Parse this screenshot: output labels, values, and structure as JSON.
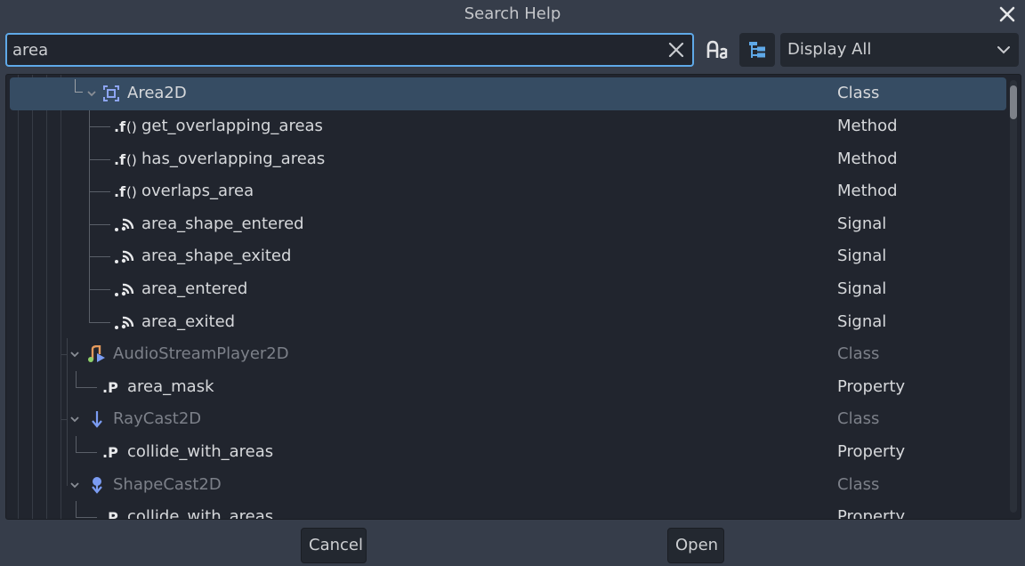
{
  "dialog": {
    "title": "Search Help",
    "close_icon": "close-icon"
  },
  "search": {
    "value": "area",
    "placeholder": "",
    "clear_icon": "clear-icon",
    "case_sensitive_icon": "case-sensitive-icon",
    "hierarchy_icon": "tree-hierarchy-icon",
    "filter_selected": "Display All"
  },
  "colors": {
    "accent": "#5fa9e8",
    "selected_row": "#364c63",
    "background": "#363d4a",
    "panel": "#21252e"
  },
  "results": [
    {
      "name": "Area2D",
      "kind": "Class",
      "icon": "area2d-icon",
      "selected": true,
      "dim": false
    },
    {
      "name": "get_overlapping_areas",
      "kind": "Method",
      "icon": "method-icon"
    },
    {
      "name": "has_overlapping_areas",
      "kind": "Method",
      "icon": "method-icon"
    },
    {
      "name": "overlaps_area",
      "kind": "Method",
      "icon": "method-icon"
    },
    {
      "name": "area_shape_entered",
      "kind": "Signal",
      "icon": "signal-icon"
    },
    {
      "name": "area_shape_exited",
      "kind": "Signal",
      "icon": "signal-icon"
    },
    {
      "name": "area_entered",
      "kind": "Signal",
      "icon": "signal-icon"
    },
    {
      "name": "area_exited",
      "kind": "Signal",
      "icon": "signal-icon"
    },
    {
      "name": "AudioStreamPlayer2D",
      "kind": "Class",
      "icon": "audio-stream-player-2d-icon",
      "dim": true
    },
    {
      "name": "area_mask",
      "kind": "Property",
      "icon": "property-icon"
    },
    {
      "name": "RayCast2D",
      "kind": "Class",
      "icon": "raycast2d-icon",
      "dim": true
    },
    {
      "name": "collide_with_areas",
      "kind": "Property",
      "icon": "property-icon"
    },
    {
      "name": "ShapeCast2D",
      "kind": "Class",
      "icon": "shapecast2d-icon",
      "dim": true
    },
    {
      "name": "collide_with_areas",
      "kind": "Property",
      "icon": "property-icon"
    }
  ],
  "buttons": {
    "cancel": "Cancel",
    "open": "Open"
  }
}
